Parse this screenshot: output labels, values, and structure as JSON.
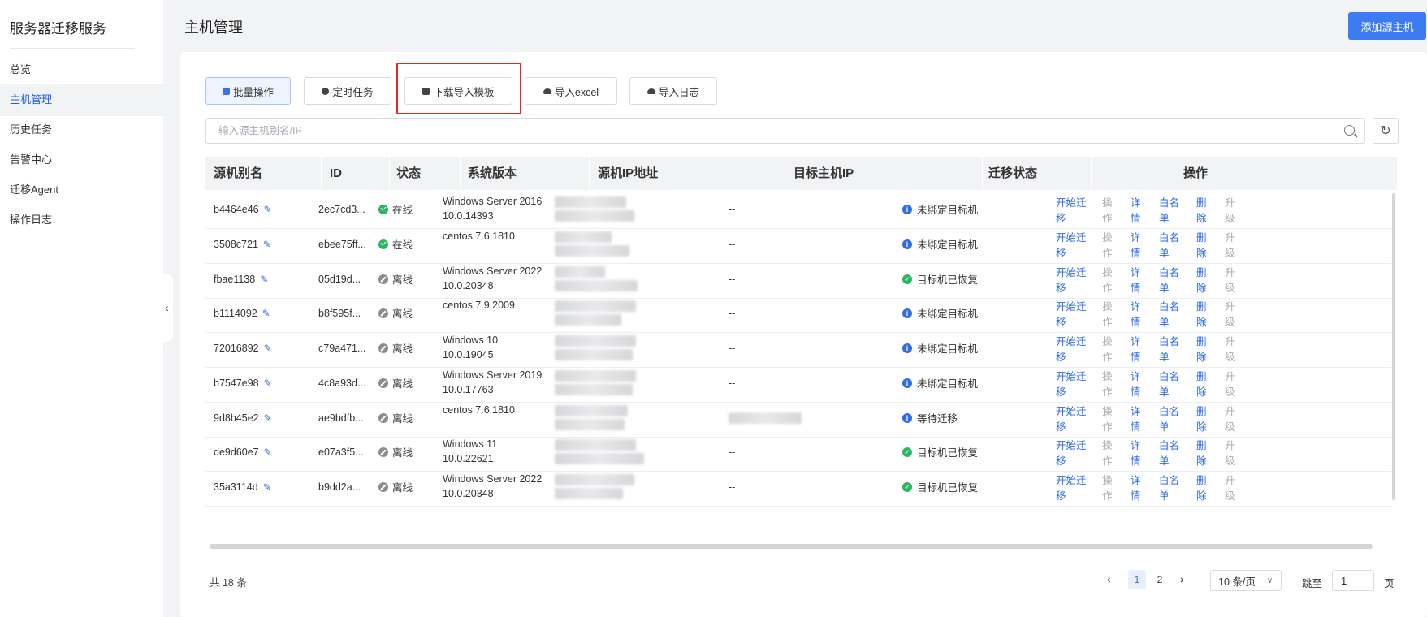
{
  "sidebar": {
    "title": "服务器迁移服务",
    "items": [
      {
        "label": "总览"
      },
      {
        "label": "主机管理",
        "active": true
      },
      {
        "label": "历史任务"
      },
      {
        "label": "告警中心"
      },
      {
        "label": "迁移Agent"
      },
      {
        "label": "操作日志"
      }
    ],
    "collapse_icon": "chevron-left-icon"
  },
  "header": {
    "title": "主机管理",
    "add_button": "添加源主机"
  },
  "toolbar": {
    "batch": "批量操作",
    "schedule": "定时任务",
    "download_template": "下载导入模板",
    "import_excel": "导入excel",
    "import_log": "导入日志"
  },
  "search": {
    "placeholder": "输入源主机别名/IP",
    "value": ""
  },
  "table": {
    "columns": [
      "源机别名",
      "ID",
      "状态",
      "系统版本",
      "源机IP地址",
      "目标主机IP",
      "迁移状态",
      "操作"
    ],
    "rows": [
      {
        "alias": "b4464e46",
        "id": "2ec7cd3...",
        "status": "在线",
        "status_type": "online",
        "os": "Windows Server 2016 10.0.14393",
        "target_ip": "--",
        "migration": "未绑定目标机",
        "migration_type": "info"
      },
      {
        "alias": "3508c721",
        "id": "ebee75ff...",
        "status": "在线",
        "status_type": "online",
        "os": "centos 7.6.1810",
        "target_ip": "--",
        "migration": "未绑定目标机",
        "migration_type": "info"
      },
      {
        "alias": "fbae1138",
        "id": "05d19d...",
        "status": "离线",
        "status_type": "offline",
        "os": "Windows Server 2022 10.0.20348",
        "target_ip": "--",
        "migration": "目标机已恢复",
        "migration_type": "ok"
      },
      {
        "alias": "b1114092",
        "id": "b8f595f...",
        "status": "离线",
        "status_type": "offline",
        "os": "centos 7.9.2009",
        "target_ip": "--",
        "migration": "未绑定目标机",
        "migration_type": "info"
      },
      {
        "alias": "72016892",
        "id": "c79a471...",
        "status": "离线",
        "status_type": "offline",
        "os": "Windows 10 10.0.19045",
        "target_ip": "--",
        "migration": "未绑定目标机",
        "migration_type": "info"
      },
      {
        "alias": "b7547e98",
        "id": "4c8a93d...",
        "status": "离线",
        "status_type": "offline",
        "os": "Windows Server 2019 10.0.17763",
        "target_ip": "--",
        "migration": "未绑定目标机",
        "migration_type": "info"
      },
      {
        "alias": "9d8b45e2",
        "id": "ae9bdfb...",
        "status": "离线",
        "status_type": "offline",
        "os": "centos 7.6.1810",
        "target_ip": "",
        "migration": "等待迁移",
        "migration_type": "info"
      },
      {
        "alias": "de9d60e7",
        "id": "e07a3f5...",
        "status": "离线",
        "status_type": "offline",
        "os": "Windows 11 10.0.22621",
        "target_ip": "--",
        "migration": "目标机已恢复",
        "migration_type": "ok"
      },
      {
        "alias": "35a3114d",
        "id": "b9dd2a...",
        "status": "离线",
        "status_type": "offline",
        "os": "Windows Server 2022 10.0.20348",
        "target_ip": "--",
        "migration": "目标机已恢复",
        "migration_type": "ok"
      }
    ],
    "actions": [
      {
        "label": "开始迁移",
        "enabled": true
      },
      {
        "label": "操作",
        "enabled": false
      },
      {
        "label": "详情",
        "enabled": true
      },
      {
        "label": "白名单",
        "enabled": true
      },
      {
        "label": "删除",
        "enabled": true
      },
      {
        "label": "升级",
        "enabled": false
      }
    ]
  },
  "pagination": {
    "total": "共 18 条",
    "pages": [
      "1",
      "2"
    ],
    "current": "1",
    "page_size": "10 条/页",
    "jump_label": "跳至",
    "jump_value": "1",
    "jump_unit": "页"
  },
  "colors": {
    "accent": "#3d7bf2",
    "link": "#2f6ae8",
    "online": "#2fb562",
    "offline": "#8a8d93",
    "highlight": "#e8262a"
  }
}
